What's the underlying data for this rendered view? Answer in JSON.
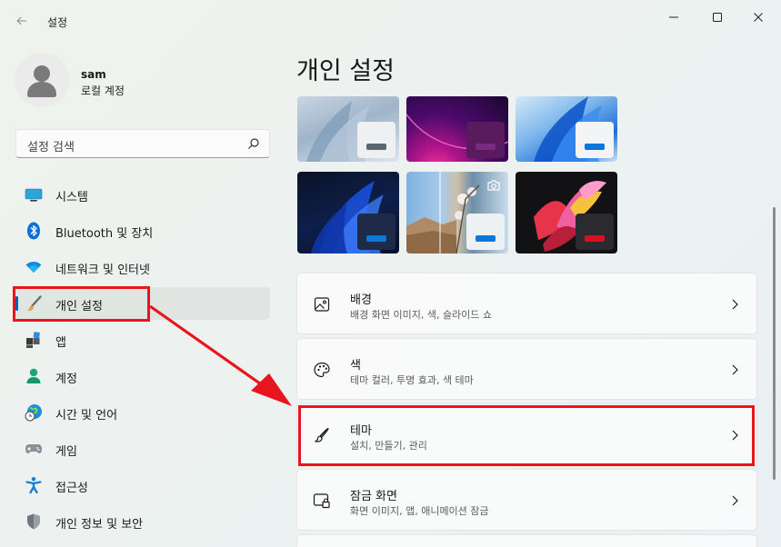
{
  "window": {
    "title": "설정",
    "back_icon": "back-arrow-icon",
    "controls": [
      "minimize-icon",
      "maximize-icon",
      "close-icon"
    ]
  },
  "user": {
    "name": "sam",
    "account_type": "로컬 계정"
  },
  "search": {
    "placeholder": "설정 검색"
  },
  "nav": {
    "items": [
      {
        "label": "시스템",
        "icon": "monitor-icon"
      },
      {
        "label": "Bluetooth 및 장치",
        "icon": "bluetooth-icon"
      },
      {
        "label": "네트워크 및 인터넷",
        "icon": "wifi-icon"
      },
      {
        "label": "개인 설정",
        "icon": "paintbrush-icon",
        "selected": true
      },
      {
        "label": "앱",
        "icon": "apps-icon"
      },
      {
        "label": "계정",
        "icon": "person-icon"
      },
      {
        "label": "시간 및 언어",
        "icon": "globe-clock-icon"
      },
      {
        "label": "게임",
        "icon": "gamepad-icon"
      },
      {
        "label": "접근성",
        "icon": "accessibility-icon"
      },
      {
        "label": "개인 정보 및 보안",
        "icon": "shield-icon"
      }
    ]
  },
  "main": {
    "title": "개인 설정",
    "settings": [
      {
        "title": "배경",
        "description": "배경 화면 이미지, 색, 슬라이드 쇼",
        "icon": "picture-icon"
      },
      {
        "title": "색",
        "description": "테마 컬러, 투명 효과, 색 테마",
        "icon": "palette-icon"
      },
      {
        "title": "테마",
        "description": "설치, 만들기, 관리",
        "icon": "brush-icon"
      },
      {
        "title": "잠금 화면",
        "description": "화면 이미지, 앱, 애니메이션 잠금",
        "icon": "lock-screen-icon"
      }
    ]
  },
  "colors": {
    "accent": "#0a5db8",
    "annotation": "#e8141e"
  }
}
